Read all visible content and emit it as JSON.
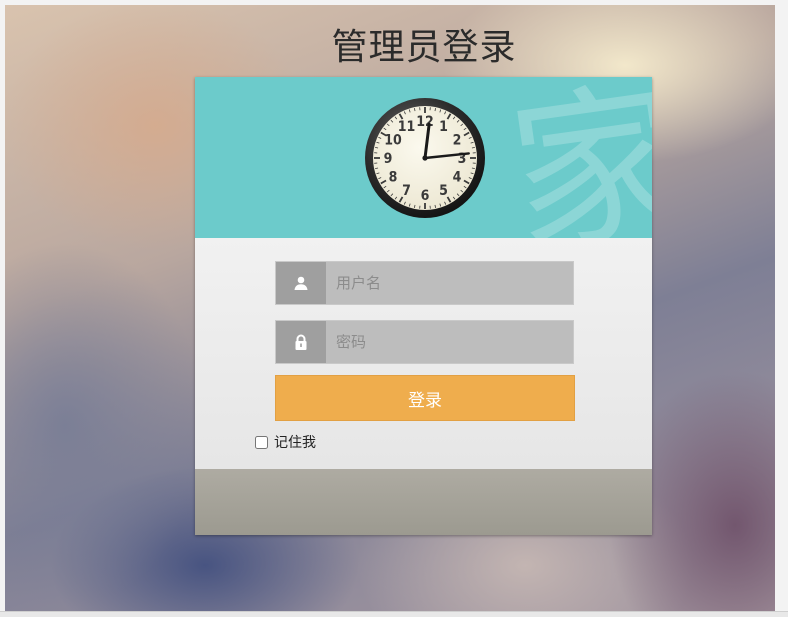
{
  "page": {
    "title": "管理员登录"
  },
  "form": {
    "username_placeholder": "用户名",
    "username_value": "",
    "password_placeholder": "密码",
    "password_value": "",
    "login_label": "登录",
    "remember_label": "记住我",
    "remember_checked": false
  },
  "clock": {
    "numerals": [
      "12",
      "1",
      "2",
      "3",
      "4",
      "5",
      "6",
      "7",
      "8",
      "9",
      "10",
      "11"
    ],
    "time": "12:14"
  },
  "colors": {
    "header": "#6ccbcb",
    "button": "#efad4d",
    "footer": "#a5a39a"
  },
  "icons": {
    "username": "user-icon",
    "password": "lock-icon"
  }
}
